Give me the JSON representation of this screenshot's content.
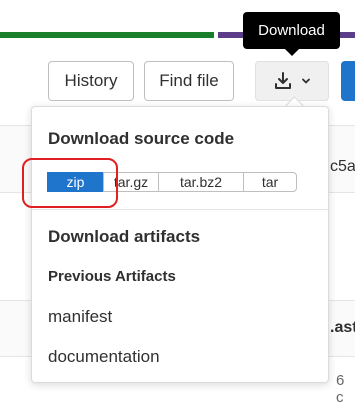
{
  "tooltip": {
    "label": "Download"
  },
  "toolbar": {
    "history_label": "History",
    "find_file_label": "Find file",
    "download_icon": "download-icon",
    "chevron_icon": "chevron-down-icon"
  },
  "background": {
    "commit_fragment": "c5a",
    "header_fragment": ".ast",
    "footer_fragment": "6 c"
  },
  "dropdown": {
    "source_heading": "Download source code",
    "formats": [
      {
        "label": "zip",
        "active": true
      },
      {
        "label": "tar.gz",
        "active": false
      },
      {
        "label": "tar.bz2",
        "active": false
      },
      {
        "label": "tar",
        "active": false
      }
    ],
    "artifacts_heading": "Download artifacts",
    "previous_heading": "Previous Artifacts",
    "artifacts": [
      {
        "label": "manifest"
      },
      {
        "label": "documentation"
      }
    ]
  },
  "colors": {
    "accent": "#1f75cb",
    "highlight": "#e02020",
    "lang_green": "#1a7f2c",
    "lang_purple": "#5b3d8a"
  }
}
